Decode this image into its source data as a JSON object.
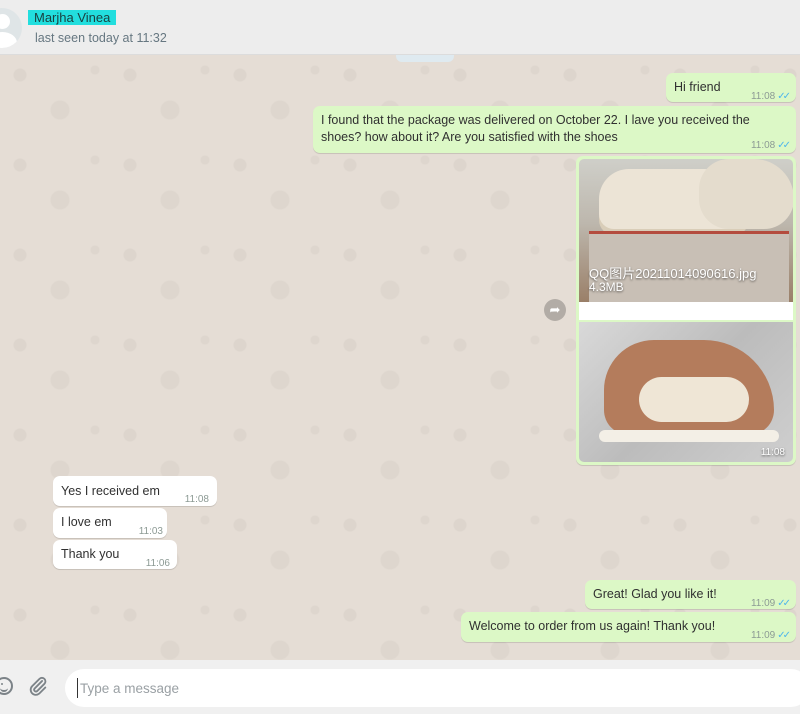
{
  "header": {
    "contact_name": "Marjha Vinea",
    "status": "last seen today at 11:32"
  },
  "messages": {
    "m1": {
      "text": "Hi friend",
      "time": "11:08"
    },
    "m2": {
      "text": "I found that the package was delivered on October 22. I lave you received the shoes? how about it? Are you satisfied with the shoes",
      "time": "11:08"
    },
    "image_msg": {
      "file_name": "QQ图片20211014090616.jpg",
      "file_size": "4.3MB",
      "time": "11:08"
    },
    "m3": {
      "text": "Yes I received em",
      "time": "11:08"
    },
    "m4": {
      "text": "I love em",
      "time": "11:03"
    },
    "m5": {
      "text": "Thank you",
      "time": "11:06"
    },
    "m6": {
      "text": "Great!  Glad you like it!",
      "time": "11:09"
    },
    "m7": {
      "text": "Welcome to order from us again! Thank you!",
      "time": "11:09"
    }
  },
  "composer": {
    "placeholder": "Type a message"
  },
  "icons": {
    "read_ticks": "double-check-icon",
    "forward": "forward-arrow-icon",
    "emoji": "emoji-icon",
    "attach": "paperclip-icon"
  },
  "colors": {
    "outgoing_bubble": "#dcf8c6",
    "incoming_bubble": "#ffffff",
    "chat_background": "#e5ddd5",
    "read_ticks": "#4fb6ec",
    "name_highlight": "#22dede"
  }
}
